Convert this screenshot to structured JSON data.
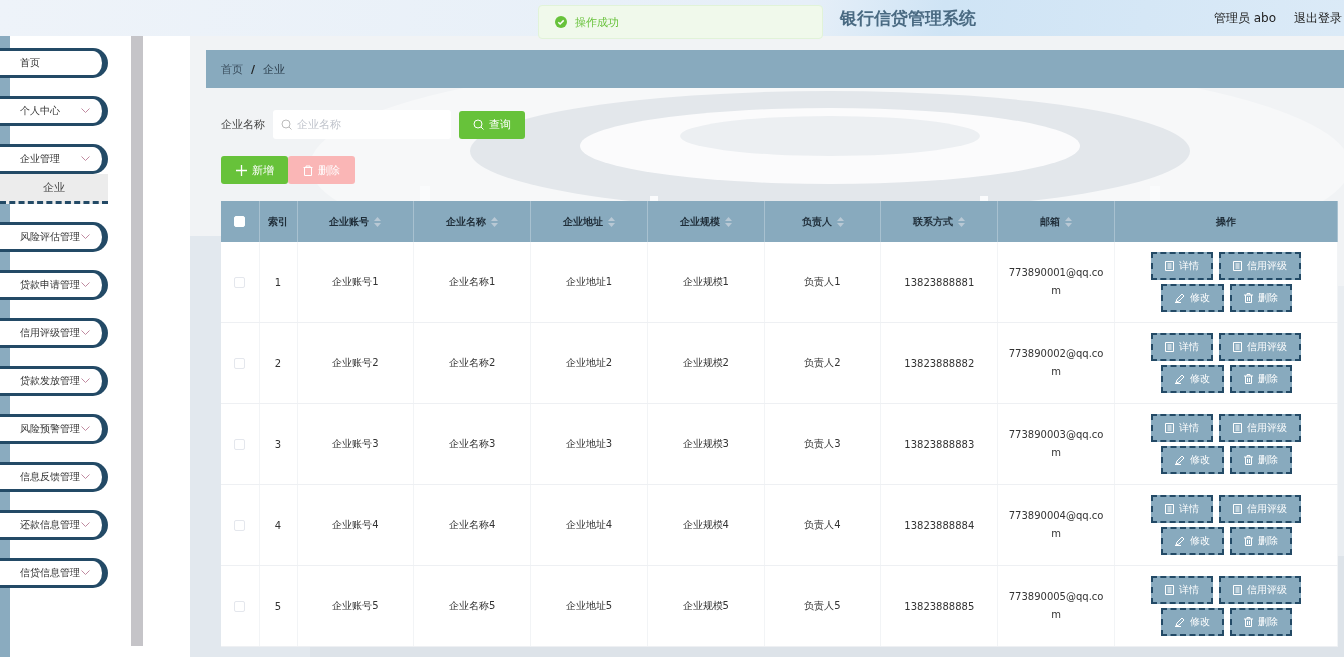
{
  "header": {
    "title": "银行信贷管理系统",
    "user": "管理员 abo",
    "logout": "退出登录"
  },
  "toast": {
    "message": "操作成功"
  },
  "sidebar": {
    "items": [
      {
        "label": "首页",
        "expandable": false
      },
      {
        "label": "个人中心",
        "expandable": true
      },
      {
        "label": "企业管理",
        "expandable": true,
        "children": [
          {
            "label": "企业",
            "selected": true
          }
        ]
      },
      {
        "label": "风险评估管理",
        "expandable": true
      },
      {
        "label": "贷款申请管理",
        "expandable": true
      },
      {
        "label": "信用评级管理",
        "expandable": true
      },
      {
        "label": "贷款发放管理",
        "expandable": true
      },
      {
        "label": "风险预警管理",
        "expandable": true
      },
      {
        "label": "信息反馈管理",
        "expandable": true
      },
      {
        "label": "还款信息管理",
        "expandable": true
      },
      {
        "label": "信贷信息管理",
        "expandable": true
      }
    ]
  },
  "breadcrumb": {
    "separator": "/",
    "items": [
      "首页",
      "企业"
    ]
  },
  "search": {
    "label": "企业名称",
    "placeholder": "企业名称",
    "button": "查询"
  },
  "actions": [
    {
      "kind": "add",
      "label": "新增",
      "disabled": false
    },
    {
      "kind": "delete",
      "label": "删除",
      "disabled": true
    }
  ],
  "table": {
    "all_checked": false,
    "columns": [
      {
        "label": "索引",
        "sortable": false
      },
      {
        "label": "企业账号",
        "sortable": true
      },
      {
        "label": "企业名称",
        "sortable": true
      },
      {
        "label": "企业地址",
        "sortable": true
      },
      {
        "label": "企业规模",
        "sortable": true
      },
      {
        "label": "负责人",
        "sortable": true
      },
      {
        "label": "联系方式",
        "sortable": true
      },
      {
        "label": "邮箱",
        "sortable": true
      },
      {
        "label": "操作",
        "sortable": false
      }
    ],
    "rows": [
      {
        "selected": false,
        "cells": [
          "1",
          "企业账号1",
          "企业名称1",
          "企业地址1",
          "企业规模1",
          "负责人1",
          "13823888881",
          "773890001@qq.com"
        ],
        "actions": [
          {
            "kind": "doc",
            "label": "详情"
          },
          {
            "kind": "doc",
            "label": "信用评级"
          },
          {
            "kind": "edit",
            "label": "修改"
          },
          {
            "kind": "delete",
            "label": "删除"
          }
        ]
      },
      {
        "selected": false,
        "cells": [
          "2",
          "企业账号2",
          "企业名称2",
          "企业地址2",
          "企业规模2",
          "负责人2",
          "13823888882",
          "773890002@qq.com"
        ],
        "actions": [
          {
            "kind": "doc",
            "label": "详情"
          },
          {
            "kind": "doc",
            "label": "信用评级"
          },
          {
            "kind": "edit",
            "label": "修改"
          },
          {
            "kind": "delete",
            "label": "删除"
          }
        ]
      },
      {
        "selected": false,
        "cells": [
          "3",
          "企业账号3",
          "企业名称3",
          "企业地址3",
          "企业规模3",
          "负责人3",
          "13823888883",
          "773890003@qq.com"
        ],
        "actions": [
          {
            "kind": "doc",
            "label": "详情"
          },
          {
            "kind": "doc",
            "label": "信用评级"
          },
          {
            "kind": "edit",
            "label": "修改"
          },
          {
            "kind": "delete",
            "label": "删除"
          }
        ]
      },
      {
        "selected": false,
        "cells": [
          "4",
          "企业账号4",
          "企业名称4",
          "企业地址4",
          "企业规模4",
          "负责人4",
          "13823888884",
          "773890004@qq.com"
        ],
        "actions": [
          {
            "kind": "doc",
            "label": "详情"
          },
          {
            "kind": "doc",
            "label": "信用评级"
          },
          {
            "kind": "edit",
            "label": "修改"
          },
          {
            "kind": "delete",
            "label": "删除"
          }
        ]
      },
      {
        "selected": false,
        "cells": [
          "5",
          "企业账号5",
          "企业名称5",
          "企业地址5",
          "企业规模5",
          "负责人5",
          "13823888885",
          "773890005@qq.com"
        ],
        "actions": [
          {
            "kind": "doc",
            "label": "详情"
          },
          {
            "kind": "doc",
            "label": "信用评级"
          },
          {
            "kind": "edit",
            "label": "修改"
          },
          {
            "kind": "delete",
            "label": "删除"
          }
        ]
      }
    ]
  }
}
